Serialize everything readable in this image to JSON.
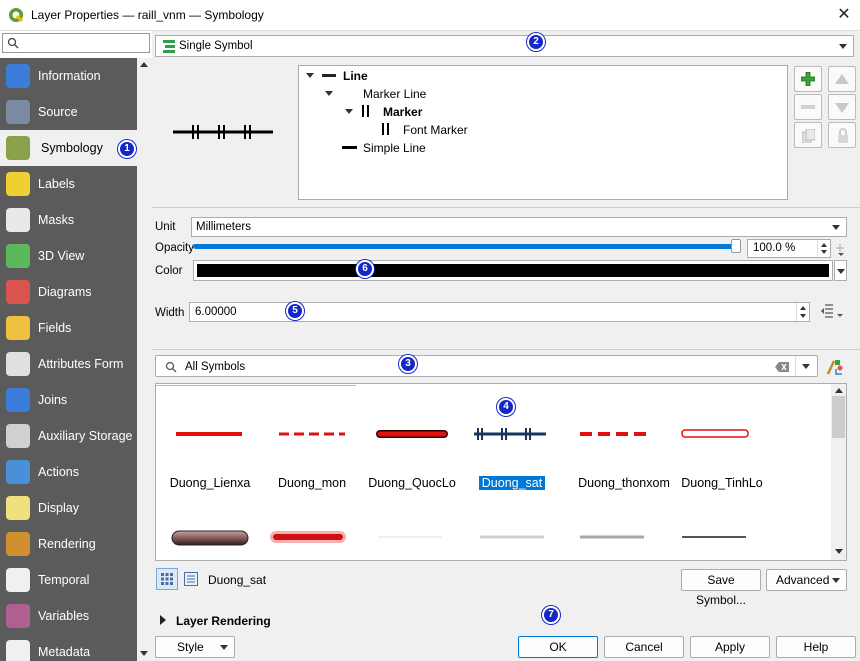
{
  "window": {
    "title": "Layer Properties — raill_vnm — Symbology",
    "close_glyph": "✕"
  },
  "sidebar": {
    "search_placeholder": "",
    "items": [
      {
        "label": "Information",
        "icon": "information-icon",
        "color": "#3b7dd8"
      },
      {
        "label": "Source",
        "icon": "source-wrench-icon",
        "color": "#7a8aa0"
      },
      {
        "label": "Symbology",
        "icon": "symbology-paintbrush-icon",
        "color": "#8aa04a"
      },
      {
        "label": "Labels",
        "icon": "labels-abc-icon",
        "color": "#f0d030"
      },
      {
        "label": "Masks",
        "icon": "masks-abc-icon",
        "color": "#e8e8e8"
      },
      {
        "label": "3D View",
        "icon": "3d-cube-icon",
        "color": "#5cb85c"
      },
      {
        "label": "Diagrams",
        "icon": "diagrams-icon",
        "color": "#d9534f"
      },
      {
        "label": "Fields",
        "icon": "fields-icon",
        "color": "#f0c040"
      },
      {
        "label": "Attributes Form",
        "icon": "attributes-form-icon",
        "color": "#e0e0e0"
      },
      {
        "label": "Joins",
        "icon": "joins-icon",
        "color": "#3b7dd8"
      },
      {
        "label": "Auxiliary Storage",
        "icon": "auxiliary-storage-icon",
        "color": "#d0d0d0"
      },
      {
        "label": "Actions",
        "icon": "actions-gear-icon",
        "color": "#4a90d9"
      },
      {
        "label": "Display",
        "icon": "display-speech-icon",
        "color": "#f0e080"
      },
      {
        "label": "Rendering",
        "icon": "rendering-brush-icon",
        "color": "#d09030"
      },
      {
        "label": "Temporal",
        "icon": "temporal-clock-icon",
        "color": "#f0f0f0"
      },
      {
        "label": "Variables",
        "icon": "variables-epsilon-icon",
        "color": "#b06090"
      },
      {
        "label": "Metadata",
        "icon": "metadata-icon",
        "color": "#f0f0f0"
      }
    ]
  },
  "renderer": {
    "selected": "Single Symbol"
  },
  "symbol_tree": [
    {
      "label": "Line",
      "bold": true
    },
    {
      "label": "Marker Line",
      "bold": false
    },
    {
      "label": "Marker",
      "bold": true
    },
    {
      "label": "Font Marker",
      "bold": false
    },
    {
      "label": "Simple Line",
      "bold": false
    }
  ],
  "unit": {
    "label": "Unit",
    "value": "Millimeters"
  },
  "opacity": {
    "label": "Opacity",
    "value": "100.0 %",
    "fraction": 1.0
  },
  "color": {
    "label": "Color",
    "value": "#000000"
  },
  "width": {
    "label": "Width",
    "value": "6.00000"
  },
  "library": {
    "search_value": "All Symbols",
    "symbols": [
      {
        "name": "Duong_Lienxa",
        "selected": false
      },
      {
        "name": "Duong_mon",
        "selected": false
      },
      {
        "name": "Duong_QuocLo",
        "selected": false
      },
      {
        "name": "Duong_sat",
        "selected": true
      },
      {
        "name": "Duong_thonxom",
        "selected": false
      },
      {
        "name": "Duong_TinhLo",
        "selected": false
      }
    ],
    "selected_name": "Duong_sat",
    "save_symbol_label": "Save Symbol...",
    "advanced_label": "Advanced"
  },
  "layer_rendering": {
    "label": "Layer Rendering"
  },
  "buttons": {
    "style": "Style",
    "ok": "OK",
    "cancel": "Cancel",
    "apply": "Apply",
    "help": "Help"
  },
  "badges": [
    "1",
    "2",
    "3",
    "4",
    "5",
    "6",
    "7"
  ],
  "accent_color": "#0078d7",
  "badge_color": "#1428c8"
}
